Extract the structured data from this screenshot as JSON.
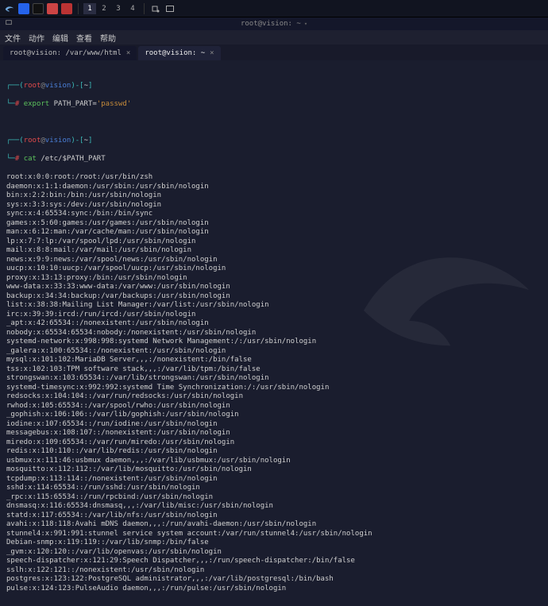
{
  "taskbar": {
    "workspaces": [
      "1",
      "2",
      "3",
      "4"
    ]
  },
  "window": {
    "title": "root@vision: ~"
  },
  "menubar": {
    "file": "文件",
    "action": "动作",
    "edit": "编辑",
    "view": "查看",
    "help": "帮助"
  },
  "tabs": [
    {
      "label": "root@vision: /var/www/html",
      "active": false
    },
    {
      "label": "root@vision: ~",
      "active": true
    }
  ],
  "prompt": {
    "user": "root",
    "at": "@",
    "host": "vision",
    "path": "~",
    "cmd1_kw": "export",
    "cmd1_rest": " PATH_PART=",
    "cmd1_val": "'passwd'",
    "cmd2_kw": "cat",
    "cmd2_rest": " /etc/$PATH_PART"
  },
  "output": [
    "root:x:0:0:root:/root:/usr/bin/zsh",
    "daemon:x:1:1:daemon:/usr/sbin:/usr/sbin/nologin",
    "bin:x:2:2:bin:/bin:/usr/sbin/nologin",
    "sys:x:3:3:sys:/dev:/usr/sbin/nologin",
    "sync:x:4:65534:sync:/bin:/bin/sync",
    "games:x:5:60:games:/usr/games:/usr/sbin/nologin",
    "man:x:6:12:man:/var/cache/man:/usr/sbin/nologin",
    "lp:x:7:7:lp:/var/spool/lpd:/usr/sbin/nologin",
    "mail:x:8:8:mail:/var/mail:/usr/sbin/nologin",
    "news:x:9:9:news:/var/spool/news:/usr/sbin/nologin",
    "uucp:x:10:10:uucp:/var/spool/uucp:/usr/sbin/nologin",
    "proxy:x:13:13:proxy:/bin:/usr/sbin/nologin",
    "www-data:x:33:33:www-data:/var/www:/usr/sbin/nologin",
    "backup:x:34:34:backup:/var/backups:/usr/sbin/nologin",
    "list:x:38:38:Mailing List Manager:/var/list:/usr/sbin/nologin",
    "irc:x:39:39:ircd:/run/ircd:/usr/sbin/nologin",
    "_apt:x:42:65534::/nonexistent:/usr/sbin/nologin",
    "nobody:x:65534:65534:nobody:/nonexistent:/usr/sbin/nologin",
    "systemd-network:x:998:998:systemd Network Management:/:/usr/sbin/nologin",
    "_galera:x:100:65534::/nonexistent:/usr/sbin/nologin",
    "mysql:x:101:102:MariaDB Server,,,:/nonexistent:/bin/false",
    "tss:x:102:103:TPM software stack,,,:/var/lib/tpm:/bin/false",
    "strongswan:x:103:65534::/var/lib/strongswan:/usr/sbin/nologin",
    "systemd-timesync:x:992:992:systemd Time Synchronization:/:/usr/sbin/nologin",
    "redsocks:x:104:104::/var/run/redsocks:/usr/sbin/nologin",
    "rwhod:x:105:65534::/var/spool/rwho:/usr/sbin/nologin",
    "_gophish:x:106:106::/var/lib/gophish:/usr/sbin/nologin",
    "iodine:x:107:65534::/run/iodine:/usr/sbin/nologin",
    "messagebus:x:108:107::/nonexistent:/usr/sbin/nologin",
    "miredo:x:109:65534::/var/run/miredo:/usr/sbin/nologin",
    "redis:x:110:110::/var/lib/redis:/usr/sbin/nologin",
    "usbmux:x:111:46:usbmux daemon,,,:/var/lib/usbmux:/usr/sbin/nologin",
    "mosquitto:x:112:112::/var/lib/mosquitto:/usr/sbin/nologin",
    "tcpdump:x:113:114::/nonexistent:/usr/sbin/nologin",
    "sshd:x:114:65534::/run/sshd:/usr/sbin/nologin",
    "_rpc:x:115:65534::/run/rpcbind:/usr/sbin/nologin",
    "dnsmasq:x:116:65534:dnsmasq,,,:/var/lib/misc:/usr/sbin/nologin",
    "statd:x:117:65534::/var/lib/nfs:/usr/sbin/nologin",
    "avahi:x:118:118:Avahi mDNS daemon,,,:/run/avahi-daemon:/usr/sbin/nologin",
    "stunnel4:x:991:991:stunnel service system account:/var/run/stunnel4:/usr/sbin/nologin",
    "Debian-snmp:x:119:119::/var/lib/snmp:/bin/false",
    "_gvm:x:120:120::/var/lib/openvas:/usr/sbin/nologin",
    "speech-dispatcher:x:121:29:Speech Dispatcher,,,:/run/speech-dispatcher:/bin/false",
    "sslh:x:122:121::/nonexistent:/usr/sbin/nologin",
    "postgres:x:123:122:PostgreSQL administrator,,,:/var/lib/postgresql:/bin/bash",
    "pulse:x:124:123:PulseAudio daemon,,,:/run/pulse:/usr/sbin/nologin"
  ]
}
